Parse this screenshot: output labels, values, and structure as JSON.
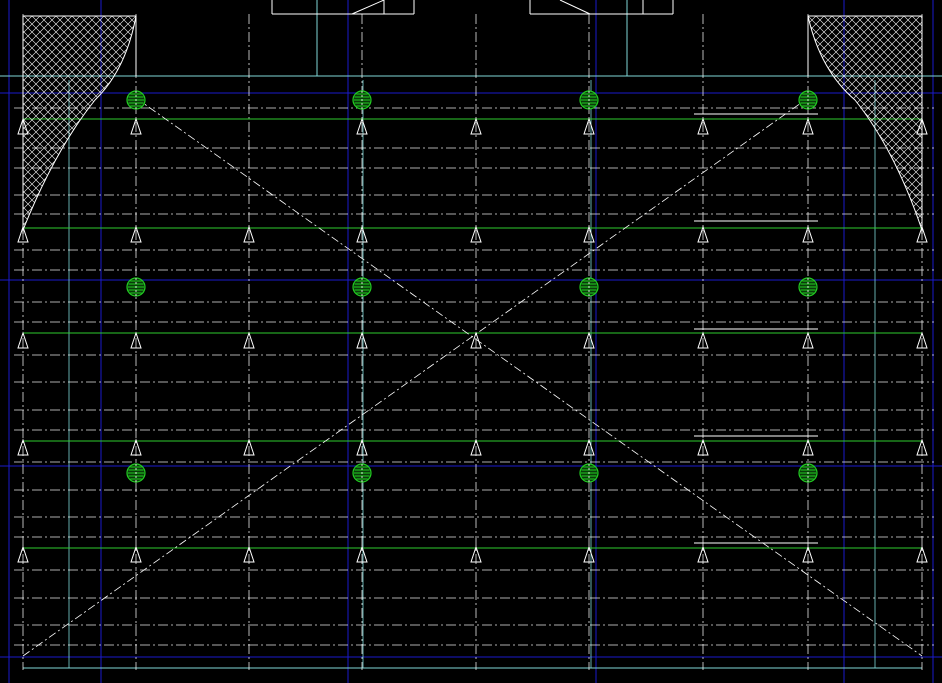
{
  "drawing": {
    "background_color": "#000000",
    "colors": {
      "structural_blue": "#1a1acc",
      "outline_cyan": "#7fd8d8",
      "beam_green": "#2ecc2e",
      "dash_white": "#ffffff",
      "hatch_white": "#ffffff",
      "column_green": "#22cc22"
    },
    "counts": {
      "column_markers": 12,
      "support_triangles": 48,
      "hatched_regions": 2
    },
    "symbols": {
      "support": "triangle-up-icon",
      "column": "circle-hatched-icon",
      "hatch": "crosshatch-pattern"
    }
  }
}
